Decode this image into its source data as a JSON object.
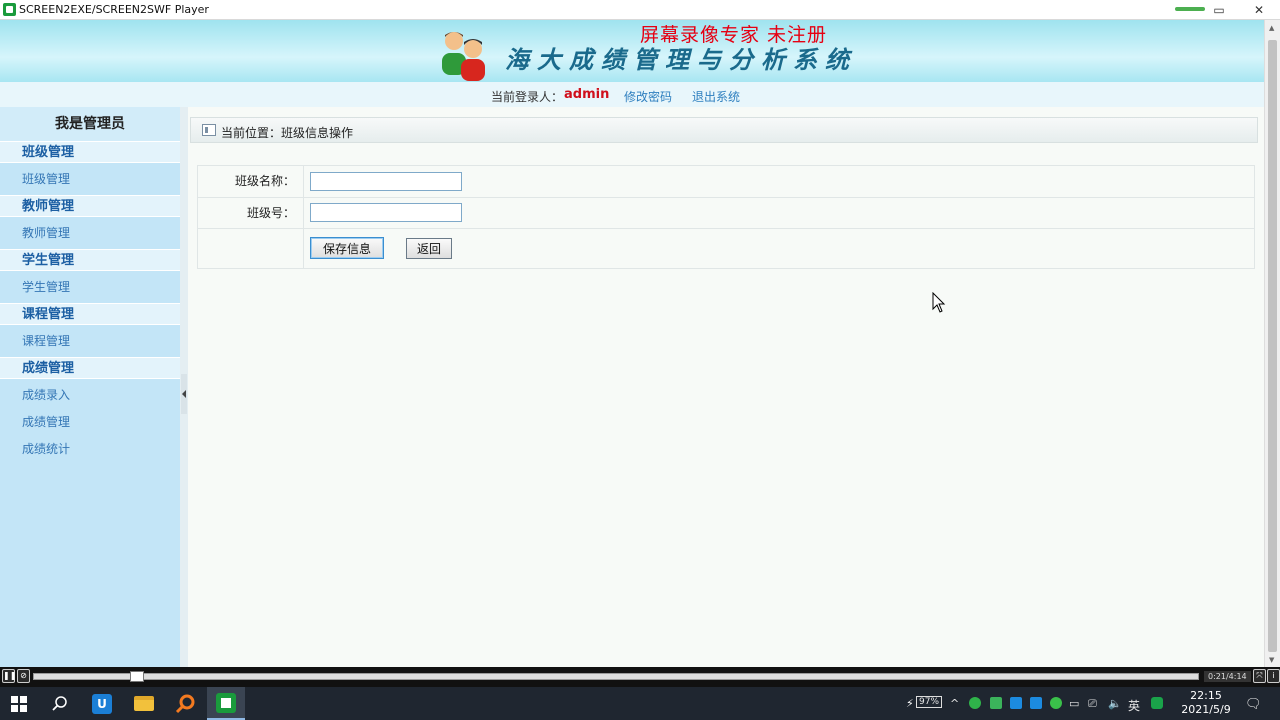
{
  "window": {
    "title": "SCREEN2EXE/SCREEN2SWF Player",
    "buttons": [
      "▭",
      "✕"
    ]
  },
  "banner": {
    "watermark": "屏幕录像专家 未注册",
    "system_title": "海大成绩管理与分析系统"
  },
  "userbar": {
    "login_label": "当前登录人：",
    "user": "admin",
    "change_password": "修改密码",
    "logout": "退出系统"
  },
  "sidebar": {
    "title": "我是管理员",
    "groups": [
      {
        "label": "班级管理",
        "items": [
          "班级管理"
        ]
      },
      {
        "label": "教师管理",
        "items": [
          "教师管理"
        ]
      },
      {
        "label": "学生管理",
        "items": [
          "学生管理"
        ]
      },
      {
        "label": "课程管理",
        "items": [
          "课程管理"
        ]
      },
      {
        "label": "成绩管理",
        "items": [
          "成绩录入",
          "成绩管理",
          "成绩统计"
        ]
      }
    ]
  },
  "breadcrumb": "当前位置：班级信息操作",
  "form": {
    "class_name_label": "班级名称：",
    "class_name_value": "",
    "class_no_label": "班级号：",
    "class_no_value": "",
    "save_button": "保存信息",
    "back_button": "返回"
  },
  "player": {
    "time": "0:21/4:14",
    "progress_fraction": 0.083
  },
  "taskbar": {
    "battery": "97%",
    "ime": "英",
    "time": "22:15",
    "date": "2021/5/9"
  }
}
